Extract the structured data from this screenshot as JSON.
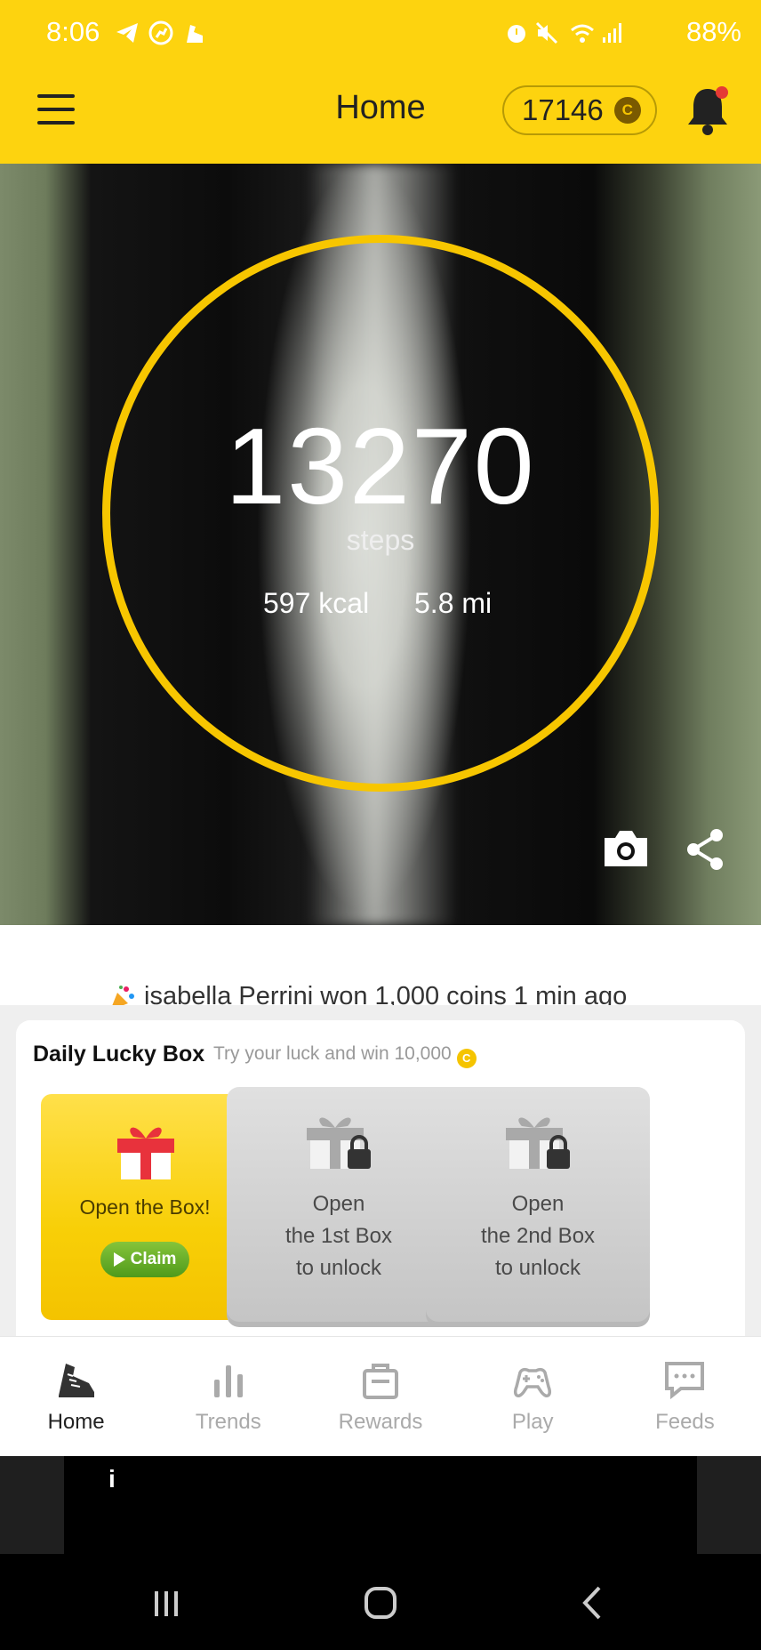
{
  "status_bar": {
    "time": "8:06",
    "battery": "88%",
    "left_icons": [
      "telegram-icon",
      "running-app-icon",
      "shoe-app-icon"
    ],
    "right_icons": [
      "alarm-icon",
      "mute-icon",
      "wifi-icon",
      "signal-icon",
      "battery-icon"
    ]
  },
  "header": {
    "title": "Home",
    "coin_balance": "17146",
    "coin_symbol": "C",
    "notification_dot": true
  },
  "hero": {
    "steps": "13270",
    "steps_label": "steps",
    "kcal": "597 kcal",
    "distance": "5.8 mi"
  },
  "ticker": {
    "text": "isabella Perrini won 1,000 coins 1 min ago"
  },
  "lucky_box": {
    "title": "Daily Lucky Box",
    "subtitle": "Try your luck and win 10,000",
    "coin_symbol": "C",
    "boxes": [
      {
        "label": "Open the Box!",
        "button": "Claim",
        "locked": false
      },
      {
        "label": "Open\nthe 1st Box\nto unlock",
        "locked": true
      },
      {
        "label": "Open\nthe 2nd Box\nto unlock",
        "locked": true
      }
    ]
  },
  "bottom_nav": {
    "items": [
      {
        "label": "Home",
        "icon": "sneaker-icon",
        "active": true
      },
      {
        "label": "Trends",
        "icon": "bar-chart-icon",
        "active": false
      },
      {
        "label": "Rewards",
        "icon": "shopping-bag-icon",
        "active": false
      },
      {
        "label": "Play",
        "icon": "gamepad-icon",
        "active": false
      },
      {
        "label": "Feeds",
        "icon": "chat-bubble-icon",
        "active": false
      }
    ]
  },
  "ad": {
    "info_glyph": "i"
  },
  "colors": {
    "accent": "#fdd30f",
    "ring": "#f7c600",
    "claim_green": "#4f9a1b"
  }
}
